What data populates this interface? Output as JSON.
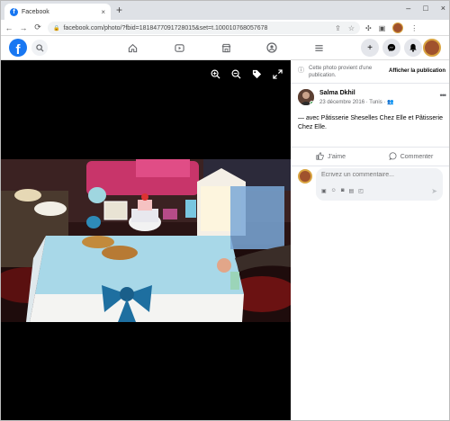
{
  "browser": {
    "tab_title": "Facebook",
    "tab_close": "×",
    "new_tab": "+",
    "window_controls": [
      "–",
      "□",
      "×"
    ],
    "url": "facebook.com/photo/?fbid=1818477091728015&set=t.100010768057678",
    "nav": {
      "back": "←",
      "forward": "→",
      "reload": "⟳"
    }
  },
  "fb_header": {
    "logo": "f",
    "nav_icons": [
      "home-icon",
      "video-icon",
      "marketplace-icon",
      "groups-icon",
      "menu-icon"
    ]
  },
  "notice": {
    "text": "Cette photo provient d'une publication.",
    "link": "Afficher la publication"
  },
  "post": {
    "author": "Salma Dkhil",
    "meta": "23 décembre 2016 · Tunis · ",
    "caption": "— avec Pâtisserie Sheselles Chez Elle et Pâtisserie Chez Elle.",
    "more": "•••"
  },
  "actions": {
    "like": "J'aime",
    "comment": "Commenter"
  },
  "comment_box": {
    "placeholder": "Écrivez un commentaire..."
  },
  "colors": {
    "fb_blue": "#1877f2",
    "photo_bg": "#000000",
    "table_cloth": "#a8d8e8",
    "bow": "#1e6fa0"
  }
}
